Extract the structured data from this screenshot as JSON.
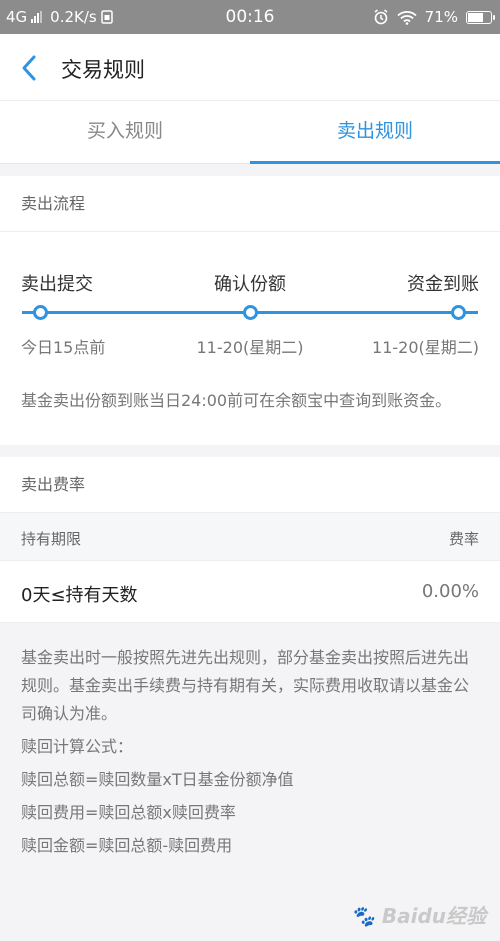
{
  "status_bar": {
    "network": "4G",
    "speed": "0.2K/s",
    "time": "00:16",
    "battery": "71%",
    "battery_level": 0.71
  },
  "nav": {
    "title": "交易规则"
  },
  "tabs": [
    {
      "label": "买入规则",
      "active": false
    },
    {
      "label": "卖出规则",
      "active": true
    }
  ],
  "sell_flow": {
    "header": "卖出流程",
    "steps": [
      {
        "label": "卖出提交",
        "date": "今日15点前"
      },
      {
        "label": "确认份额",
        "date": "11-20(星期二)"
      },
      {
        "label": "资金到账",
        "date": "11-20(星期二)"
      }
    ],
    "note": "基金卖出份额到账当日24:00前可在余额宝中查询到账资金。"
  },
  "sell_fee": {
    "header": "卖出费率",
    "columns": [
      "持有期限",
      "费率"
    ],
    "rows": [
      {
        "period": "0天≤持有天数",
        "rate": "0.00%"
      }
    ]
  },
  "rules": [
    "基金卖出时一般按照先进先出规则，部分基金卖出按照后进先出规则。基金卖出手续费与持有期有关，实际费用收取请以基金公司确认为准。",
    "赎回计算公式：",
    "赎回总额=赎回数量xT日基金份额净值",
    "赎回费用=赎回总额x赎回费率",
    "赎回金额=赎回总额-赎回费用"
  ],
  "watermark": "Baidu经验",
  "colors": {
    "accent": "#2f93e0",
    "status_bar_bg": "#8c8c8c"
  }
}
